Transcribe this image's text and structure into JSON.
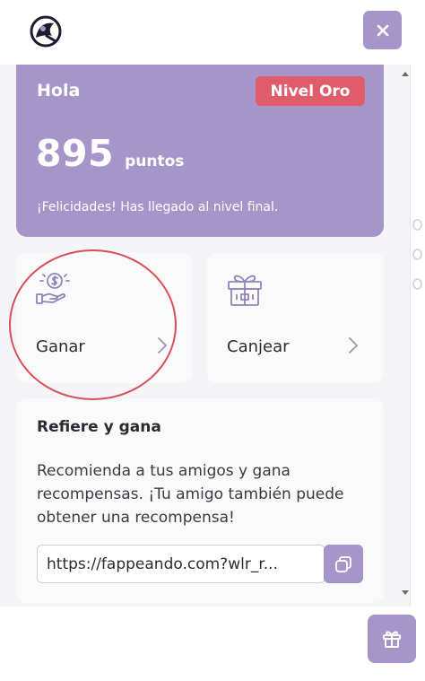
{
  "header": {
    "logo_icon": "brand-logo-icon",
    "close_icon": "close-icon"
  },
  "points_card": {
    "greeting": "Hola",
    "level_badge": "Nivel Oro",
    "points_value": "895",
    "points_unit": "puntos",
    "message": "¡Felicidades! Has llegado al nivel final."
  },
  "actions": {
    "earn_label": "Ganar",
    "earn_icon": "coin-hand-icon",
    "redeem_label": "Canjear",
    "redeem_icon": "gift-icon"
  },
  "referral": {
    "title": "Refiere y gana",
    "description": "Recomienda a tus amigos y gana recompensas. ¡Tu amigo también puede obtener una recompensa!",
    "link_value": "https://fappeando.com?wlr_r...",
    "copy_icon": "copy-icon"
  },
  "launcher": {
    "icon": "gift-icon"
  },
  "colors": {
    "accent": "#a595c8",
    "badge": "#e15c6b",
    "annotation": "#d8505c"
  }
}
